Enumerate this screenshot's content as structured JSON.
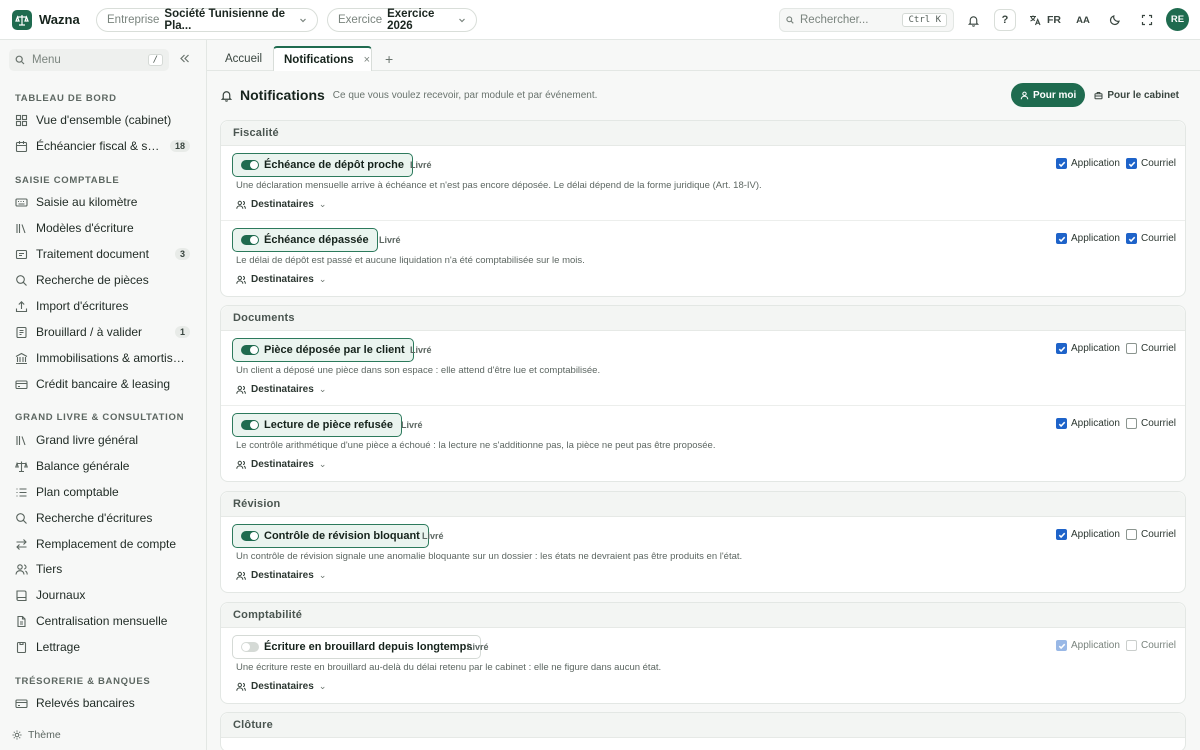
{
  "app": {
    "name": "Wazna"
  },
  "topbar": {
    "company_label": "Entreprise",
    "company_value": "Société Tunisienne de Pla...",
    "year_label": "Exercice",
    "year_value": "Exercice 2026",
    "search_placeholder": "Rechercher...",
    "search_shortcut": "Ctrl K",
    "help_label": "?",
    "language": "FR",
    "font_size_label": "AA",
    "user_initials": "RE"
  },
  "sidebar": {
    "menu_search": "Menu",
    "menu_shortcut": "/",
    "sections": [
      {
        "title": "TABLEAU DE BORD",
        "items": [
          {
            "label": "Vue d'ensemble (cabinet)",
            "icon": "dashboard-icon"
          },
          {
            "label": "Échéancier fiscal & soc...",
            "icon": "calendar-icon",
            "badge": "18"
          }
        ]
      },
      {
        "title": "SAISIE COMPTABLE",
        "items": [
          {
            "label": "Saisie au kilomètre",
            "icon": "keyboard-icon"
          },
          {
            "label": "Modèles d'écriture",
            "icon": "library-icon"
          },
          {
            "label": "Traitement document",
            "icon": "document-icon",
            "badge": "3"
          },
          {
            "label": "Recherche de pièces",
            "icon": "search-icon"
          },
          {
            "label": "Import d'écritures",
            "icon": "upload-icon"
          },
          {
            "label": "Brouillard / à valider",
            "icon": "draft-icon",
            "badge": "1"
          },
          {
            "label": "Immobilisations & amortisse...",
            "icon": "building-icon"
          },
          {
            "label": "Crédit bancaire & leasing",
            "icon": "card-icon"
          }
        ]
      },
      {
        "title": "GRAND LIVRE & CONSULTATION",
        "items": [
          {
            "label": "Grand livre général",
            "icon": "library-icon"
          },
          {
            "label": "Balance générale",
            "icon": "scale-icon"
          },
          {
            "label": "Plan comptable",
            "icon": "list-icon"
          },
          {
            "label": "Recherche d'écritures",
            "icon": "search-icon"
          },
          {
            "label": "Remplacement de compte",
            "icon": "swap-icon"
          },
          {
            "label": "Tiers",
            "icon": "users-icon"
          },
          {
            "label": "Journaux",
            "icon": "book-icon"
          },
          {
            "label": "Centralisation mensuelle",
            "icon": "file-icon"
          },
          {
            "label": "Lettrage",
            "icon": "link-icon"
          }
        ]
      },
      {
        "title": "TRÉSORERIE & BANQUES",
        "items": [
          {
            "label": "Relevés bancaires",
            "icon": "bank-icon"
          }
        ]
      }
    ],
    "theme_label": "Thème"
  },
  "tabs": [
    {
      "label": "Accueil"
    },
    {
      "label": "Notifications",
      "active": true
    }
  ],
  "page": {
    "title": "Notifications",
    "subtitle": "Ce que vous voulez recevoir, par module et par événement.",
    "scope_buttons": [
      {
        "label": "Pour moi",
        "active": true
      },
      {
        "label": "Pour le cabinet",
        "active": false
      }
    ]
  },
  "channels": {
    "app": "Application",
    "mail": "Courriel"
  },
  "recipients_label": "Destinataires",
  "sections": [
    {
      "title": "Fiscalité",
      "rules": [
        {
          "title": "Échéance de dépôt proche",
          "status": "Livré",
          "enabled": true,
          "app": true,
          "mail": true,
          "description": "Une déclaration mensuelle arrive à échéance et n'est pas encore déposée. Le délai dépend de la forme juridique (Art. 18-IV)."
        },
        {
          "title": "Échéance dépassée",
          "status": "Livré",
          "enabled": true,
          "app": true,
          "mail": true,
          "description": "Le délai de dépôt est passé et aucune liquidation n'a été comptabilisée sur le mois."
        }
      ]
    },
    {
      "title": "Documents",
      "rules": [
        {
          "title": "Pièce déposée par le client",
          "status": "Livré",
          "enabled": true,
          "app": true,
          "mail": false,
          "description": "Un client a déposé une pièce dans son espace : elle attend d'être lue et comptabilisée."
        },
        {
          "title": "Lecture de pièce refusée",
          "status": "Livré",
          "enabled": true,
          "app": true,
          "mail": false,
          "description": "Le contrôle arithmétique d'une pièce a échoué : la lecture ne s'additionne pas, la pièce ne peut pas être proposée."
        }
      ]
    },
    {
      "title": "Révision",
      "rules": [
        {
          "title": "Contrôle de révision bloquant",
          "status": "Livré",
          "enabled": true,
          "app": true,
          "mail": false,
          "description": "Un contrôle de révision signale une anomalie bloquante sur un dossier : les états ne devraient pas être produits en l'état."
        }
      ]
    },
    {
      "title": "Comptabilité",
      "rules": [
        {
          "title": "Écriture en brouillard depuis longtemps",
          "status": "Livré",
          "enabled": false,
          "app": true,
          "mail": false,
          "description": "Une écriture reste en brouillard au-delà du délai retenu par le cabinet : elle ne figure dans aucun état."
        }
      ]
    },
    {
      "title": "Clôture",
      "rules": []
    }
  ],
  "colors": {
    "brand": "#1f6b4f",
    "checkbox": "#1e63c9"
  }
}
